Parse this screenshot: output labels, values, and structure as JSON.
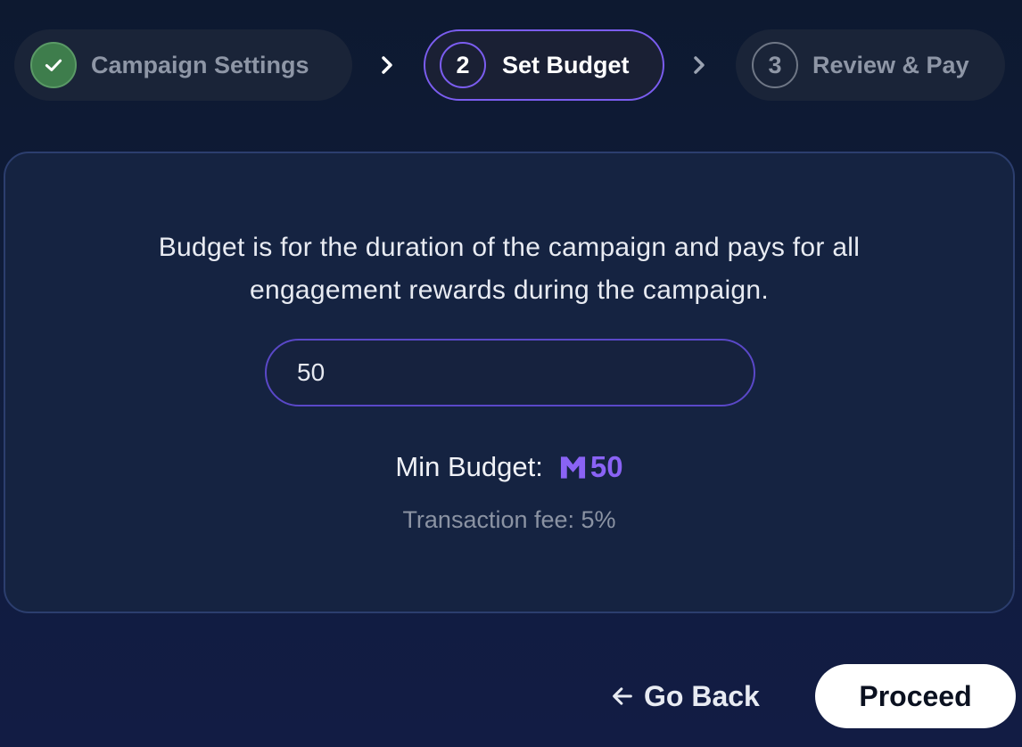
{
  "stepper": {
    "steps": [
      {
        "number": "✓",
        "label": "Campaign Settings",
        "state": "completed"
      },
      {
        "number": "2",
        "label": "Set Budget",
        "state": "active"
      },
      {
        "number": "3",
        "label": "Review & Pay",
        "state": "upcoming"
      }
    ]
  },
  "card": {
    "description_line1": "Budget is for the duration of the campaign and pays for all",
    "description_line2": "engagement rewards during the campaign.",
    "budget_input_value": "50",
    "min_budget_label": "Min Budget:",
    "min_budget_value": "50",
    "currency_icon": "m-coin-icon",
    "transaction_fee": "Transaction fee: 5%"
  },
  "actions": {
    "back_label": "Go Back",
    "proceed_label": "Proceed"
  },
  "colors": {
    "accent": "#7b5df0",
    "completed": "#3e7d4c",
    "background": "#0d1930",
    "card": "#152341"
  }
}
